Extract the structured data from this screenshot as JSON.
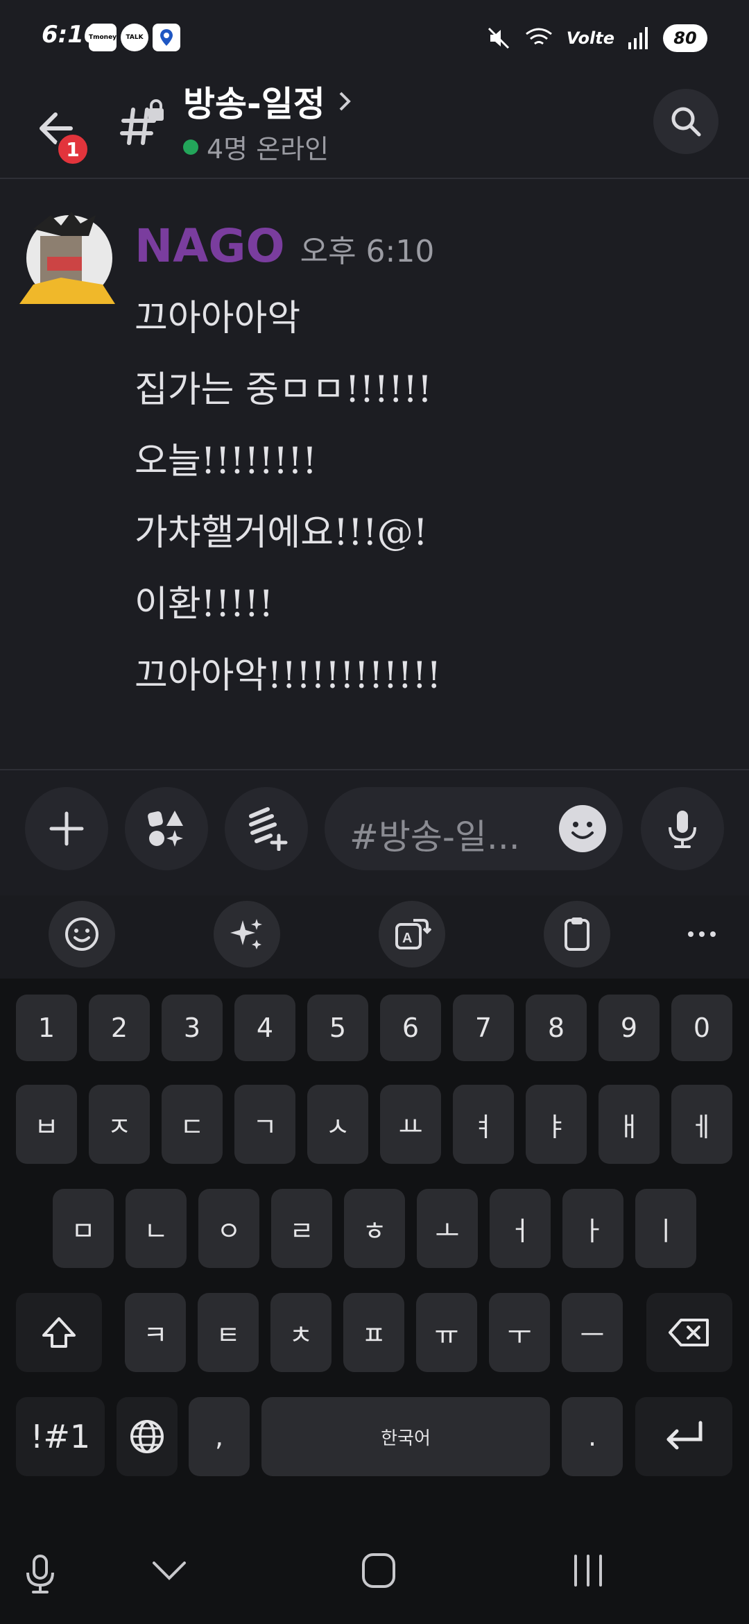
{
  "status": {
    "time": "6:10",
    "apps": [
      "Tmoney",
      "TALK",
      "Map"
    ],
    "volte": "Volte",
    "battery": "80"
  },
  "header": {
    "notification_count": "1",
    "channel_name": "방송-일정",
    "online_text": "4명 온라인",
    "online_color": "#23a55a"
  },
  "message": {
    "author": "NAGO",
    "author_color": "#7a3d9e",
    "time": "오후 6:10",
    "lines": [
      "끄아아아악",
      "집가는 중ㅁㅁ!!!!!!",
      "오늘!!!!!!!!",
      "가챠핼거에요!!!@!",
      "이환!!!!!",
      "끄아아악!!!!!!!!!!!!"
    ]
  },
  "composer": {
    "placeholder": "#방송-일..."
  },
  "keyboard": {
    "row1": [
      "1",
      "2",
      "3",
      "4",
      "5",
      "6",
      "7",
      "8",
      "9",
      "0"
    ],
    "row2": [
      "ㅂ",
      "ㅈ",
      "ㄷ",
      "ㄱ",
      "ㅅ",
      "ㅛ",
      "ㅕ",
      "ㅑ",
      "ㅐ",
      "ㅔ"
    ],
    "row3": [
      "ㅁ",
      "ㄴ",
      "ㅇ",
      "ㄹ",
      "ㅎ",
      "ㅗ",
      "ㅓ",
      "ㅏ",
      "ㅣ"
    ],
    "row4": [
      "ㅋ",
      "ㅌ",
      "ㅊ",
      "ㅍ",
      "ㅠ",
      "ㅜ",
      "ㅡ"
    ],
    "symbols_label": "!#1",
    "comma": ",",
    "space_label": "한국어",
    "period": "."
  }
}
